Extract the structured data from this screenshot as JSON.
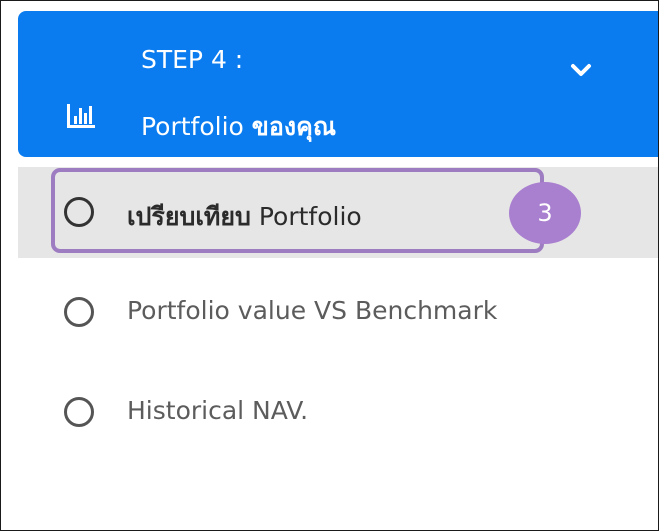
{
  "header": {
    "step_label": "STEP 4 :",
    "title_latin": "Portfolio ",
    "title_thai": "ของคุณ",
    "color": "#0a7cf0",
    "icon": "bar-chart-icon",
    "toggle_icon": "chevron-down-icon"
  },
  "menu": {
    "items": [
      {
        "label_thai": "เปรียบเทียบ",
        "label_latin": " Portfolio",
        "active": true
      },
      {
        "label": "Portfolio value VS Benchmark",
        "active": false
      },
      {
        "label": "Historical NAV.",
        "active": false
      }
    ],
    "active_row_color": "#e6e6e6"
  },
  "annotation": {
    "badge_number": "3",
    "highlight_color": "#9d7cc2",
    "badge_color": "#a97fcf"
  }
}
